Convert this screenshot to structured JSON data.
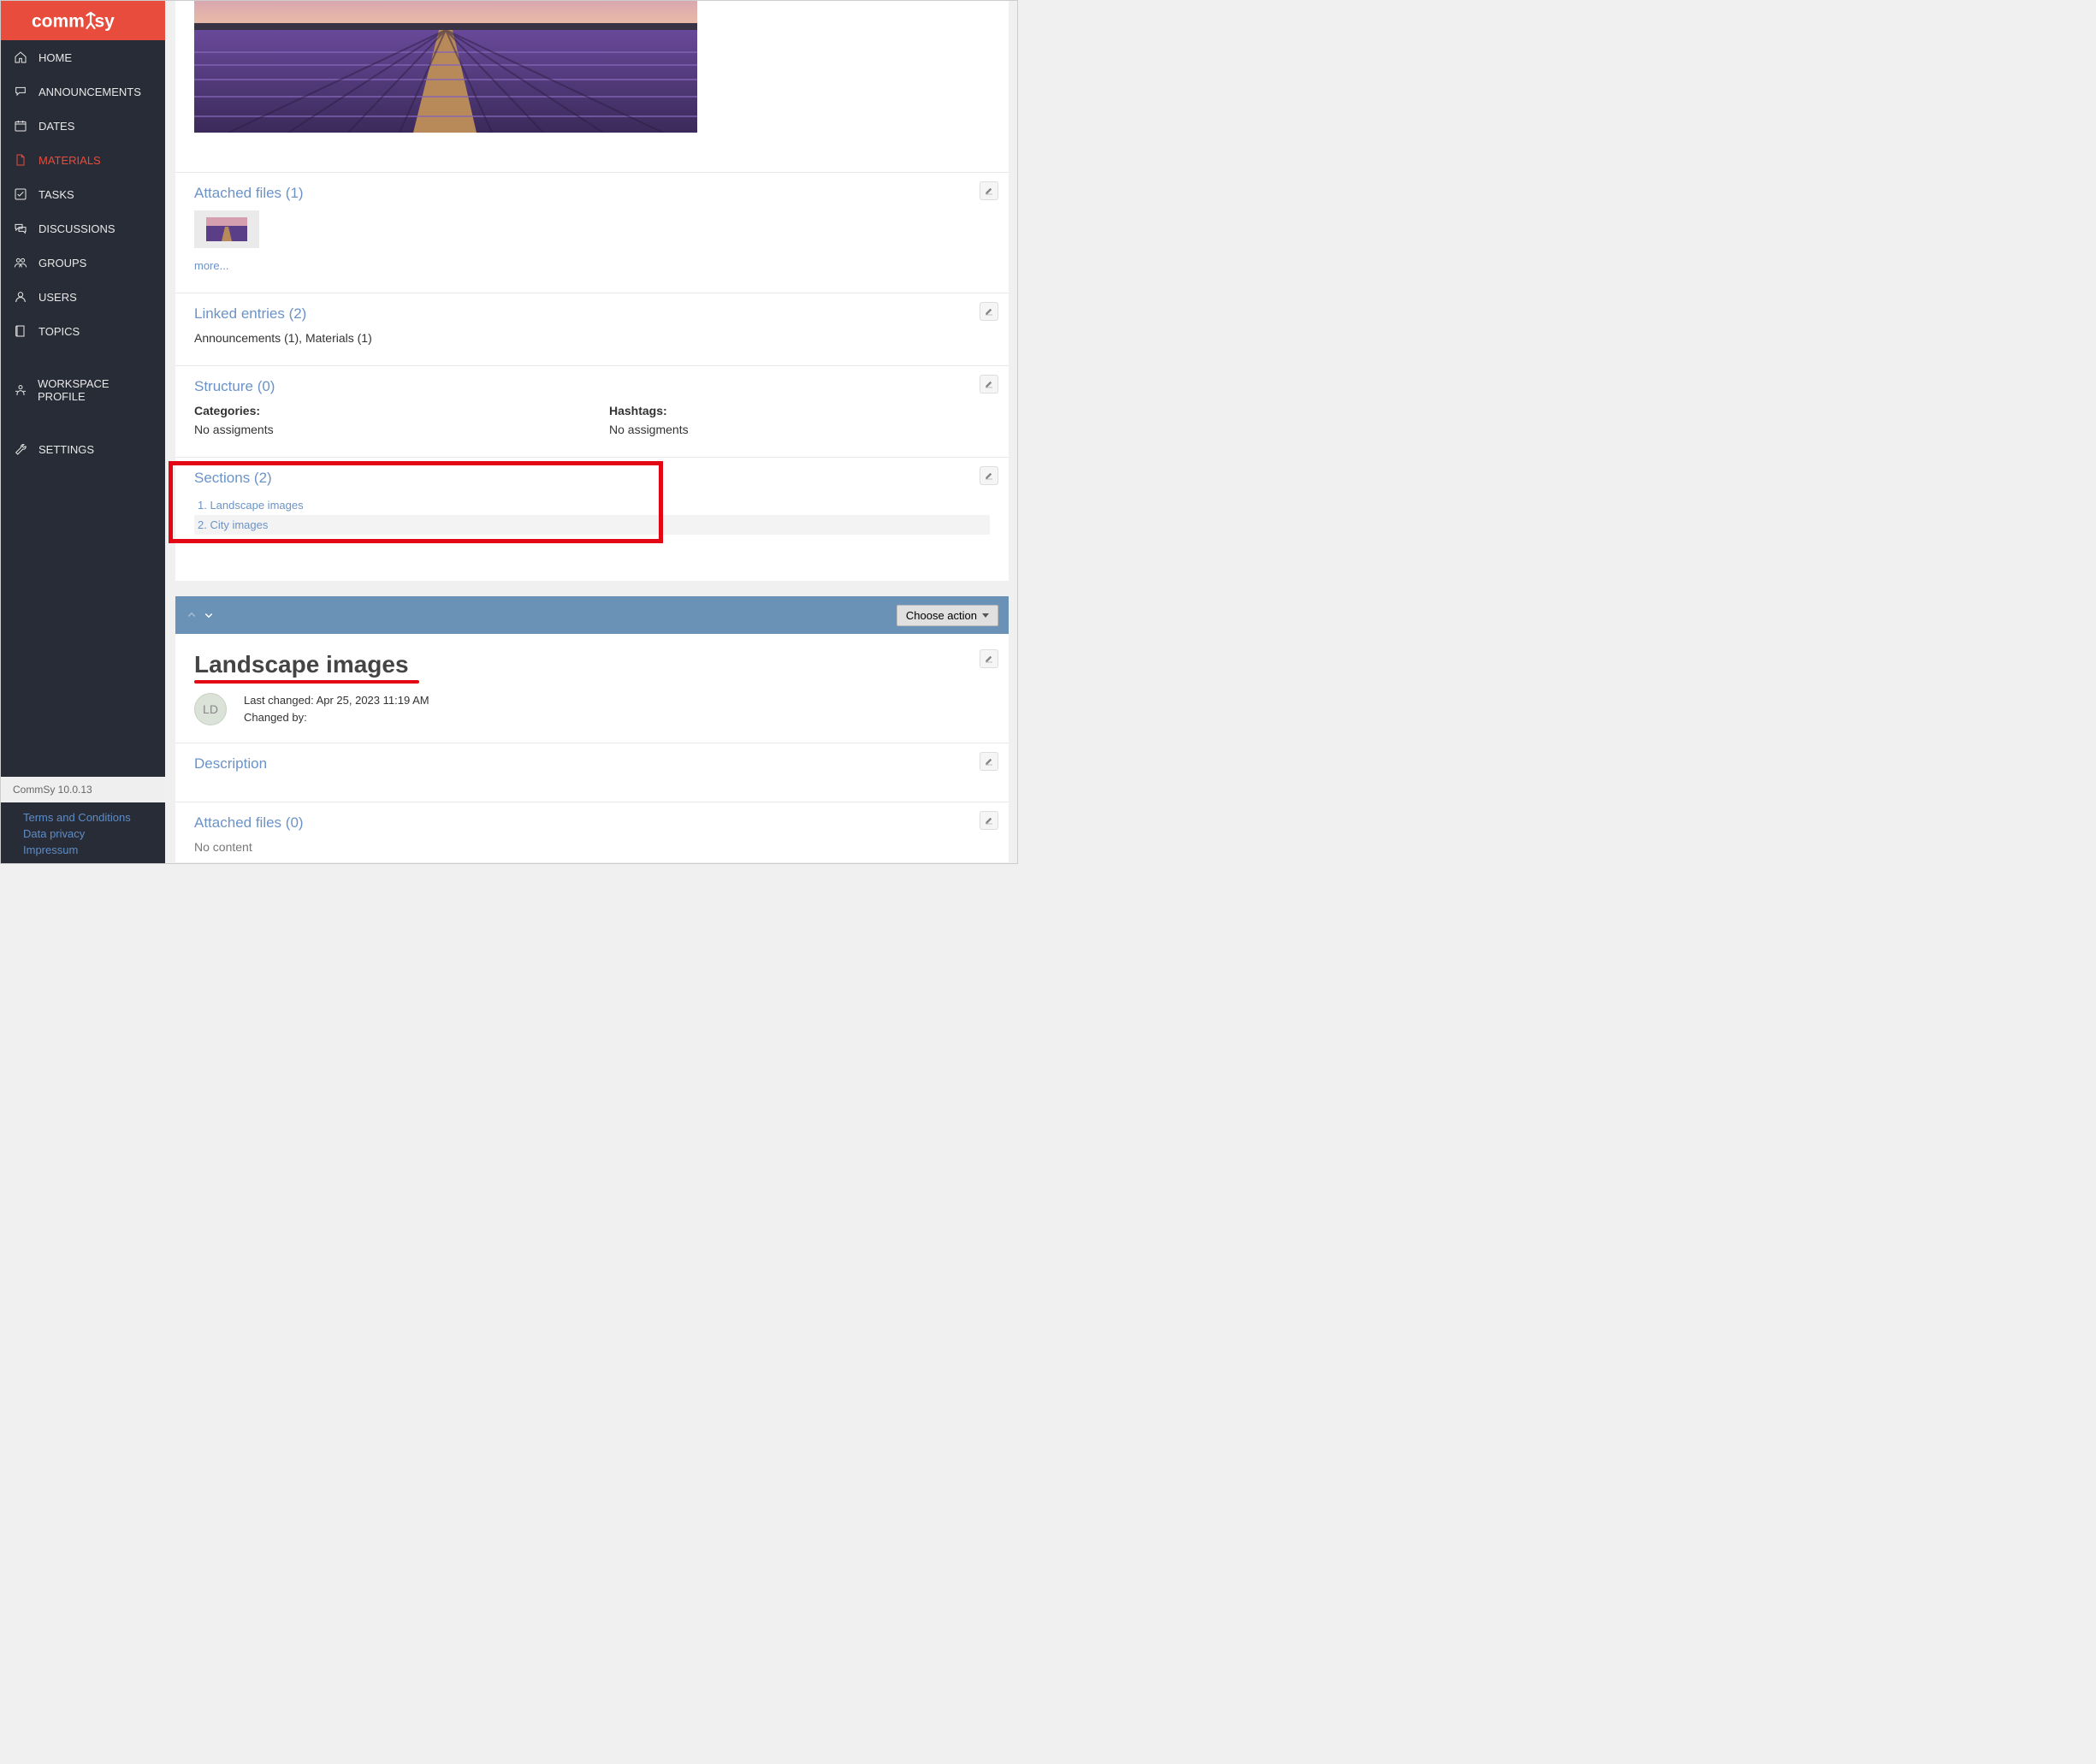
{
  "brand": "commsy",
  "nav": {
    "home": "HOME",
    "announcements": "ANNOUNCEMENTS",
    "dates": "DATES",
    "materials": "MATERIALS",
    "tasks": "TASKS",
    "discussions": "DISCUSSIONS",
    "groups": "GROUPS",
    "users": "USERS",
    "topics": "TOPICS",
    "workspace_profile": "WORKSPACE PROFILE",
    "settings": "SETTINGS"
  },
  "version": "CommSy 10.0.13",
  "footer": {
    "terms": "Terms and Conditions",
    "privacy": "Data privacy",
    "impressum": "Impressum"
  },
  "attached": {
    "heading": "Attached files (1)",
    "more": "more..."
  },
  "linked": {
    "heading": "Linked entries (2)",
    "text": "Announcements (1), Materials (1)"
  },
  "structure": {
    "heading": "Structure (0)",
    "categories_label": "Categories:",
    "categories_value": "No assigments",
    "hashtags_label": "Hashtags:",
    "hashtags_value": "No assigments"
  },
  "sections": {
    "heading": "Sections (2)",
    "items": [
      {
        "label": "1. Landscape images"
      },
      {
        "label": "2. City images"
      }
    ]
  },
  "sub": {
    "choose_action": "Choose action",
    "title": "Landscape images",
    "avatar": "LD",
    "last_changed": "Last changed: Apr 25, 2023 11:19 AM",
    "changed_by": "Changed by:",
    "description_heading": "Description",
    "attached_heading": "Attached files (0)",
    "attached_text": "No content"
  }
}
